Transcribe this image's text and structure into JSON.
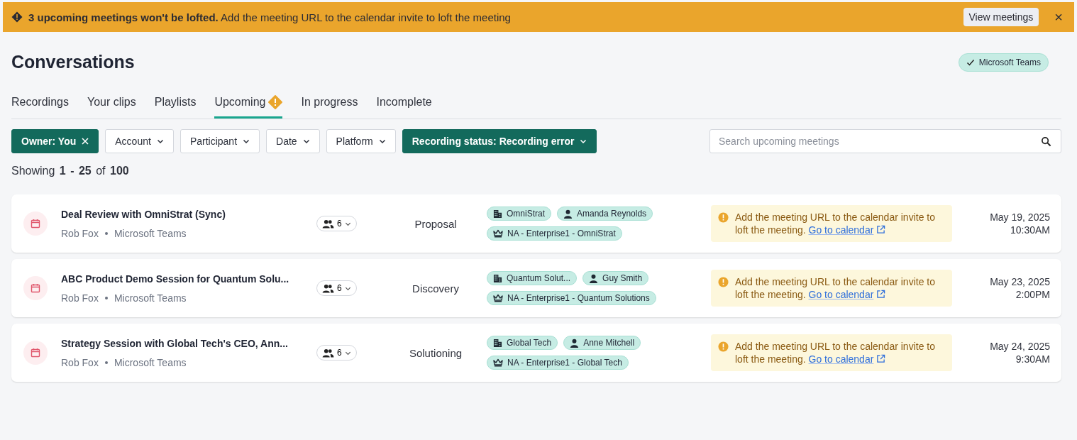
{
  "banner": {
    "message": "**3 upcoming meetings won't be lofted.** Add the meeting URL to the calendar invite to loft the meeting",
    "action": "View meetings",
    "close": "×"
  },
  "page": {
    "title": "Conversations",
    "platform_badge": "Microsoft Teams"
  },
  "tabs": [
    {
      "label": "Recordings",
      "selected": false,
      "warning": false
    },
    {
      "label": "Your clips",
      "selected": false,
      "warning": false
    },
    {
      "label": "Playlists",
      "selected": false,
      "warning": false
    },
    {
      "label": "Upcoming",
      "selected": true,
      "warning": true
    },
    {
      "label": "In progress",
      "selected": false,
      "warning": false
    },
    {
      "label": "Incomplete",
      "selected": false,
      "warning": false
    }
  ],
  "filters": [
    {
      "label": "Owner: You",
      "active": true,
      "kind": "removable"
    },
    {
      "label": "Account",
      "active": false,
      "kind": "dropdown"
    },
    {
      "label": "Participant",
      "active": false,
      "kind": "dropdown"
    },
    {
      "label": "Date",
      "active": false,
      "kind": "dropdown"
    },
    {
      "label": "Platform",
      "active": false,
      "kind": "dropdown"
    },
    {
      "label": "Recording status: Recording error",
      "active": true,
      "kind": "dropdown"
    }
  ],
  "search": {
    "placeholder": "Search upcoming meetings"
  },
  "showing": "Showing **1 - 25** of **100**",
  "meetings": [
    {
      "title": "Deal Review with OmniStrat (Sync)",
      "owner": "Rob Fox",
      "platform": "Microsoft Teams",
      "participants": "6",
      "stage": "Proposal",
      "tags": [
        {
          "kind": "account",
          "label": "OmniStrat"
        },
        {
          "kind": "contact",
          "label": "Amanda Reynolds"
        },
        {
          "kind": "territory",
          "label": "NA - Enterprise1 - OmniStrat"
        }
      ],
      "warning": "Add the meeting URL to the calendar invite to loft the meeting.",
      "link": "Go to calendar",
      "date": "May 19, 2025",
      "time": "10:30AM"
    },
    {
      "title": "ABC Product Demo Session for Quantum Solu...",
      "owner": "Rob Fox",
      "platform": "Microsoft Teams",
      "participants": "6",
      "stage": "Discovery",
      "tags": [
        {
          "kind": "account",
          "label": "Quantum Solut..."
        },
        {
          "kind": "contact",
          "label": "Guy Smith"
        },
        {
          "kind": "territory",
          "label": "NA - Enterprise1 - Quantum Solutions"
        }
      ],
      "warning": "Add the meeting URL to the calendar invite to loft the meeting.",
      "link": "Go to calendar",
      "date": "May 23, 2025",
      "time": "2:00PM"
    },
    {
      "title": "Strategy Session with Global Tech's CEO, Ann...",
      "owner": "Rob Fox",
      "platform": "Microsoft Teams",
      "participants": "6",
      "stage": "Solutioning",
      "tags": [
        {
          "kind": "account",
          "label": "Global Tech"
        },
        {
          "kind": "contact",
          "label": "Anne Mitchell"
        },
        {
          "kind": "territory",
          "label": "NA - Enterprise1 - Global Tech"
        }
      ],
      "warning": "Add the meeting URL to the calendar invite to loft the meeting.",
      "link": "Go to calendar",
      "date": "May 24, 2025",
      "time": "9:30AM"
    }
  ]
}
